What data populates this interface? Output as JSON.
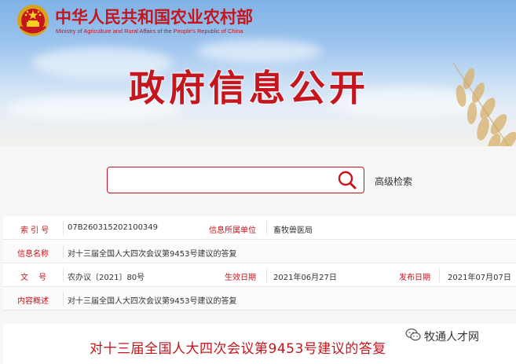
{
  "header": {
    "org_name_cn": "中华人民共和国农业农村部",
    "org_name_en": "Ministry of Agriculture and Rural Affairs of the People's Republic of China",
    "page_heading": "政府信息公开",
    "emblem_icon": "national-emblem-icon"
  },
  "search": {
    "placeholder": "",
    "value": "",
    "advanced_label": "高级检索",
    "icon": "search-icon"
  },
  "info": {
    "index_label": "索 引 号",
    "index_value": "07B260315202100349",
    "dept_label": "信息所属单位",
    "dept_value": "畜牧兽医局",
    "name_label": "信息名称",
    "name_value": "对十三届全国人大四次会议第9453号建议的答复",
    "docno_label": "文　 号",
    "docno_value": "农办议〔2021〕80号",
    "effective_label": "生效日期",
    "effective_value": "2021年06月27日",
    "published_label": "发布日期",
    "published_value": "2021年07月07日",
    "summary_label": "内容概述",
    "summary_value": "对十三届全国人大四次会议第9453号建议的答复"
  },
  "document": {
    "title": "对十三届全国人大四次会议第9453号建议的答复"
  },
  "watermark": {
    "text": "牧通人才网",
    "icon": "wechat-icon"
  },
  "colors": {
    "brand_red": "#c4161c",
    "sky_blue": "#7fb2e6"
  }
}
